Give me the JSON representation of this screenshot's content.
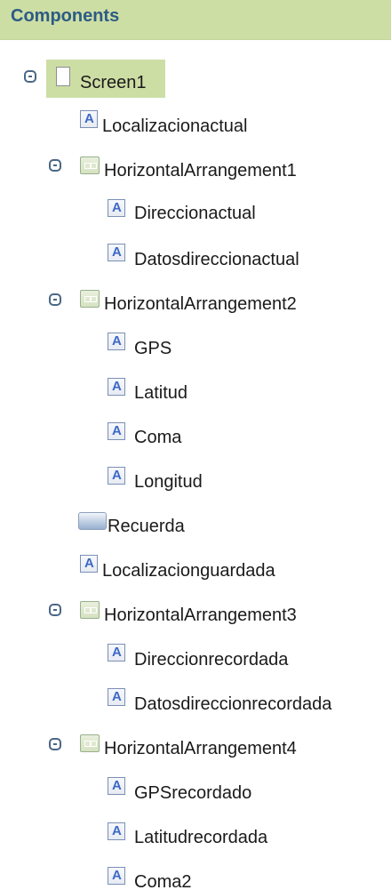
{
  "header": {
    "title": "Components"
  },
  "tree": {
    "items": [
      {
        "label": "Screen1",
        "type": "screen",
        "expanded": true,
        "selected": true
      },
      {
        "label": "Localizacionactual",
        "type": "label"
      },
      {
        "label": "HorizontalArrangement1",
        "type": "arrangement",
        "expanded": true
      },
      {
        "label": "Direccionactual",
        "type": "label"
      },
      {
        "label": "Datosdireccionactual",
        "type": "label"
      },
      {
        "label": "HorizontalArrangement2",
        "type": "arrangement",
        "expanded": true
      },
      {
        "label": "GPS",
        "type": "label"
      },
      {
        "label": "Latitud",
        "type": "label"
      },
      {
        "label": "Coma",
        "type": "label"
      },
      {
        "label": "Longitud",
        "type": "label"
      },
      {
        "label": "Recuerda",
        "type": "button"
      },
      {
        "label": "Localizacionguardada",
        "type": "label"
      },
      {
        "label": "HorizontalArrangement3",
        "type": "arrangement",
        "expanded": true
      },
      {
        "label": "Direccionrecordada",
        "type": "label"
      },
      {
        "label": "Datosdireccionrecordada",
        "type": "label"
      },
      {
        "label": "HorizontalArrangement4",
        "type": "arrangement",
        "expanded": true
      },
      {
        "label": "GPSrecordado",
        "type": "label"
      },
      {
        "label": "Latitudrecordada",
        "type": "label"
      },
      {
        "label": "Coma2",
        "type": "label"
      }
    ]
  }
}
